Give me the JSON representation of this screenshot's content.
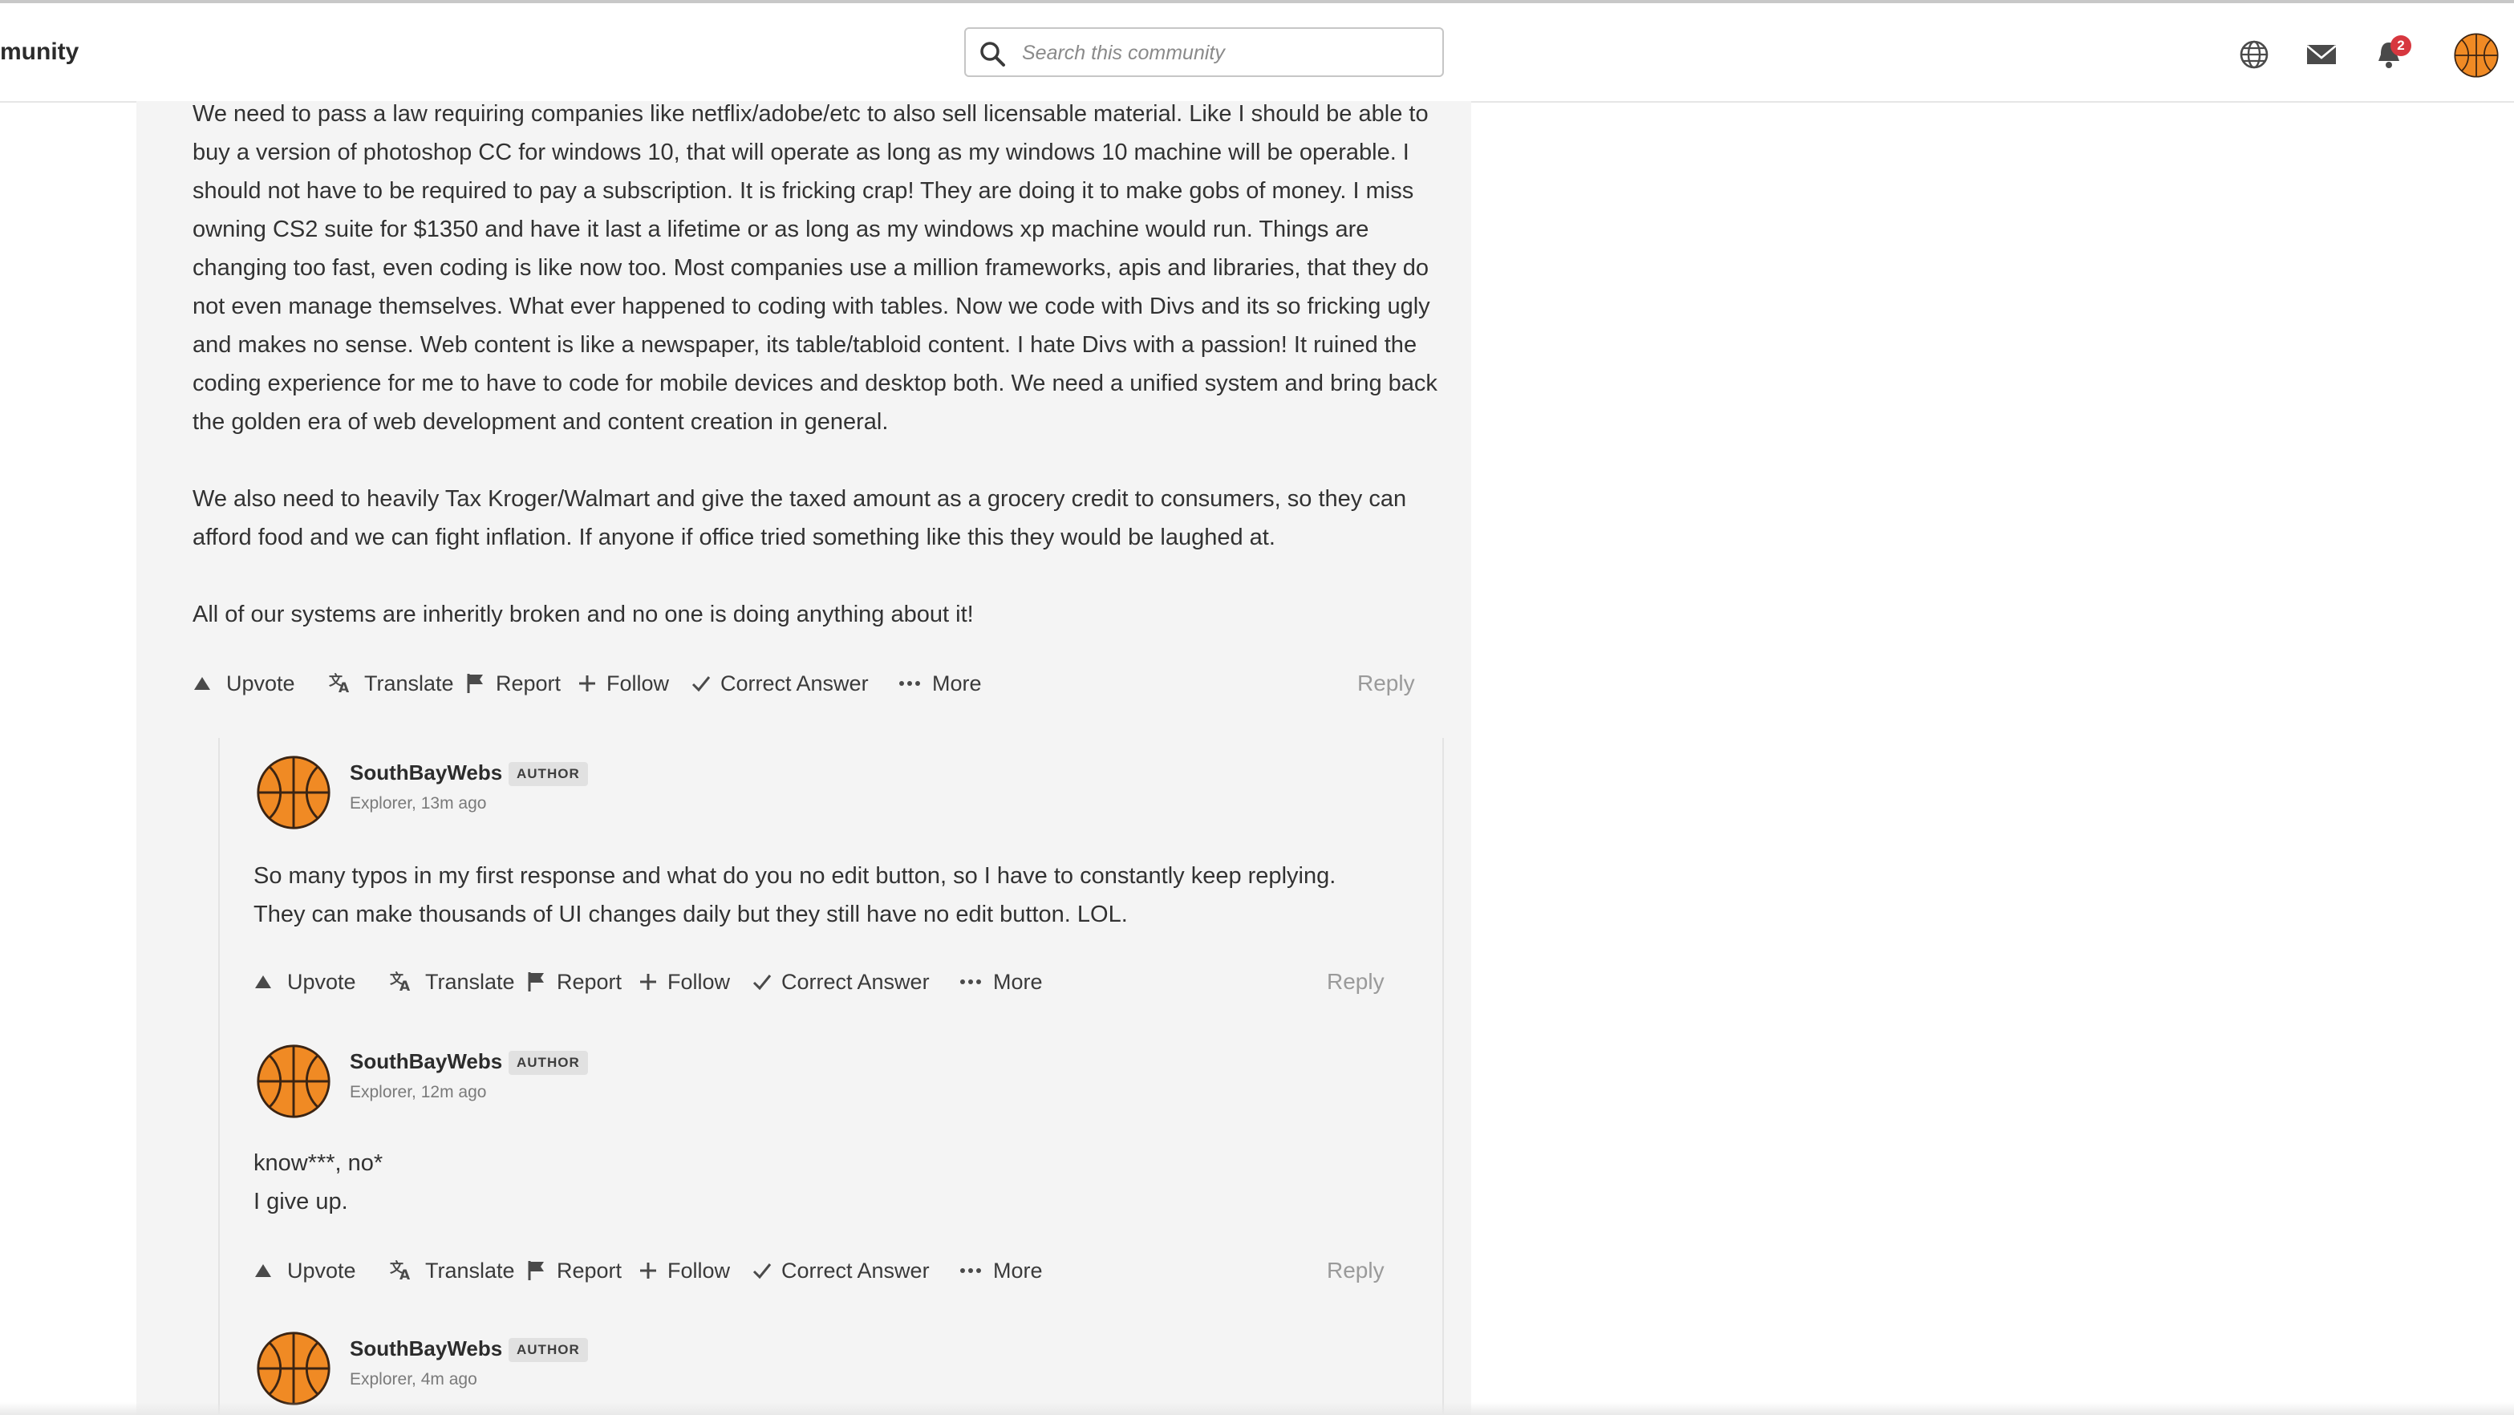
{
  "header": {
    "brand": "munity",
    "search_placeholder": "Search this community",
    "notification_count": "2"
  },
  "icons": {
    "language": "globe-icon",
    "messages": "envelope-icon",
    "notifications": "bell-icon",
    "avatar": "basketball-icon"
  },
  "colors": {
    "badge": "#d7373f",
    "panel": "#f4f4f4"
  },
  "post": {
    "paragraphs": [
      "We need to pass a law requiring companies like netflix/adobe/etc to also sell licensable material. Like I should be able to buy a version of photoshop CC for windows 10, that will operate as long as my windows 10 machine will be operable. I should not have to be required to pay a subscription. It is fricking crap! They are doing it to make gobs of money. I miss owning CS2 suite for $1350 and have it last a lifetime or as long as my windows xp machine would run. Things are changing too fast, even coding is like now too. Most companies use a million frameworks, apis and libraries, that they do not even manage themselves. What ever happened to coding with tables. Now we code with Divs and its so fricking ugly and makes no sense. Web content is like a newspaper, its table/tabloid content. I hate Divs with a passion! It ruined the coding experience for me to have to code for mobile devices and desktop both. We need a unified system and bring back the golden era of web development and content creation in general.",
      "We also need to heavily Tax Kroger/Walmart and give the taxed amount as a grocery credit to consumers, so they can afford food and we can fight inflation. If anyone if office tried something like this they would be laughed at.",
      "All of our systems are inheritly broken and no one is doing anything about it!"
    ]
  },
  "actions": {
    "upvote": "Upvote",
    "translate": "Translate",
    "report": "Report",
    "follow": "Follow",
    "correct": "Correct Answer",
    "more": "More",
    "reply": "Reply"
  },
  "replies": [
    {
      "author": "SouthBayWebs",
      "badge": "AUTHOR",
      "meta": "Explorer, 13m ago",
      "lines": [
        "So many typos in my first response and what do you no edit button, so I have to constantly keep replying.",
        "They can make thousands of UI changes daily but they still have no edit button. LOL."
      ]
    },
    {
      "author": "SouthBayWebs",
      "badge": "AUTHOR",
      "meta": "Explorer, 12m ago",
      "lines": [
        "know***, no*",
        "I give up."
      ]
    },
    {
      "author": "SouthBayWebs",
      "badge": "AUTHOR",
      "meta": "Explorer, 4m ago",
      "lines": []
    }
  ]
}
